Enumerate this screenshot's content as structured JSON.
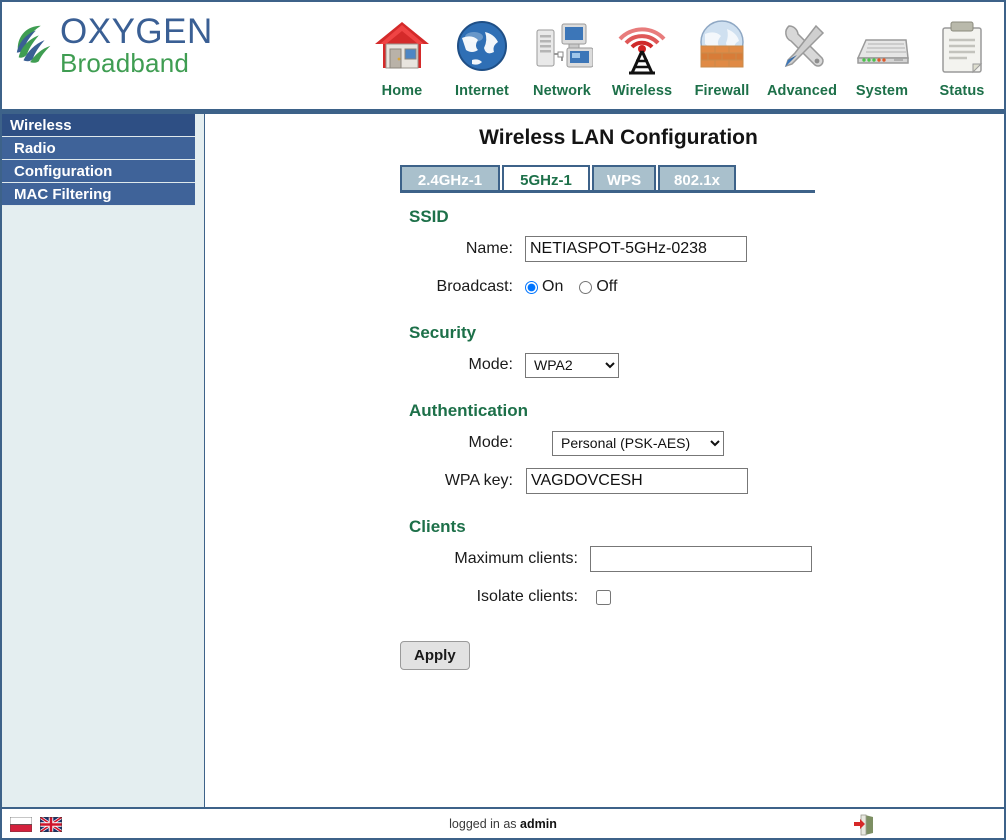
{
  "brand": {
    "name_primary": "OXYGEN",
    "name_secondary": "Broadband",
    "color_primary": "#3a5f94",
    "color_secondary": "#3f9d52"
  },
  "nav": {
    "items": [
      {
        "label": "Home",
        "icon": "house-icon"
      },
      {
        "label": "Internet",
        "icon": "globe-icon"
      },
      {
        "label": "Network",
        "icon": "computers-icon"
      },
      {
        "label": "Wireless",
        "icon": "antenna-icon"
      },
      {
        "label": "Firewall",
        "icon": "brick-wall-globe-icon"
      },
      {
        "label": "Advanced",
        "icon": "wrench-screwdriver-icon"
      },
      {
        "label": "System",
        "icon": "modem-icon"
      },
      {
        "label": "Status",
        "icon": "clipboard-icon"
      }
    ],
    "active": "Wireless",
    "label_color": "#1d7049"
  },
  "sidebar": {
    "header": "Wireless",
    "items": [
      {
        "label": "Radio"
      },
      {
        "label": "Configuration"
      },
      {
        "label": "MAC Filtering"
      }
    ],
    "active": "Configuration",
    "header_color": "#2e4f84",
    "item_color": "#3f6399"
  },
  "main": {
    "title": "Wireless LAN Configuration",
    "tabs": [
      {
        "label": "2.4GHz-1",
        "active": false
      },
      {
        "label": "5GHz-1",
        "active": true
      },
      {
        "label": "WPS",
        "active": false
      },
      {
        "label": "802.1x",
        "active": false
      }
    ],
    "sections": {
      "ssid": {
        "title": "SSID",
        "name_label": "Name:",
        "name_value": "NETIASPOT-5GHz-0238",
        "broadcast_label": "Broadcast:",
        "broadcast_on": "On",
        "broadcast_off": "Off",
        "broadcast_selected": "On"
      },
      "security": {
        "title": "Security",
        "mode_label": "Mode:",
        "mode_value": "WPA2",
        "mode_options": [
          "WPA2"
        ]
      },
      "authentication": {
        "title": "Authentication",
        "mode_label": "Mode:",
        "mode_value": "Personal (PSK-AES)",
        "mode_options": [
          "Personal (PSK-AES)"
        ],
        "wpa_key_label": "WPA key:",
        "wpa_key_value": "VAGDOVCESH"
      },
      "clients": {
        "title": "Clients",
        "max_label": "Maximum clients:",
        "max_value": "",
        "isolate_label": "Isolate clients:",
        "isolate_checked": false
      }
    },
    "apply_label": "Apply"
  },
  "footer": {
    "flags": [
      {
        "name": "poland-flag"
      },
      {
        "name": "uk-flag"
      }
    ],
    "status_prefix": "logged in as ",
    "status_user": "admin",
    "logout_icon": "logout-icon"
  }
}
